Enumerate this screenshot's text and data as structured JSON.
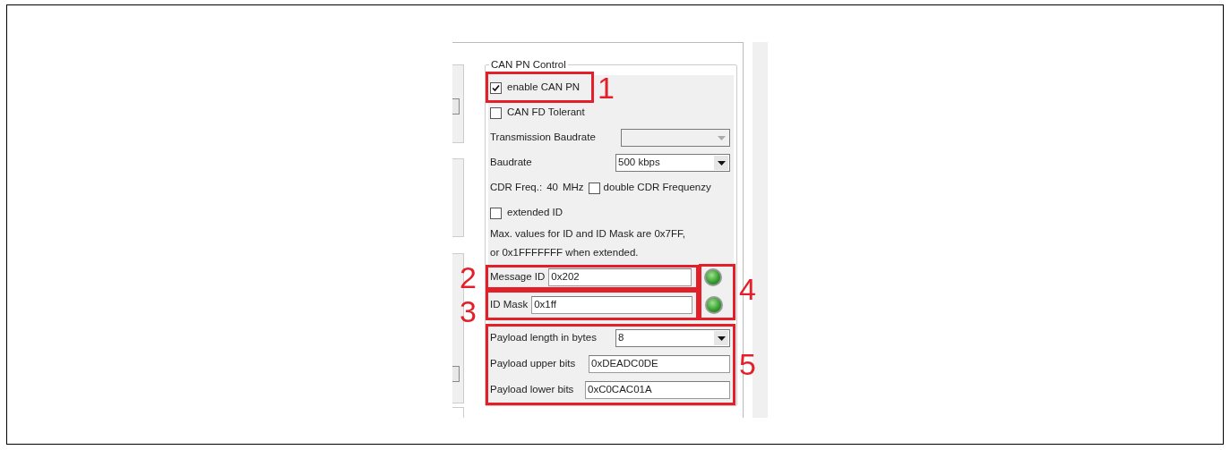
{
  "group_title": "CAN PN Control",
  "enable_can_pn": {
    "label": "enable CAN PN",
    "checked": true
  },
  "can_fd_tolerant": {
    "label": "CAN FD Tolerant",
    "checked": false
  },
  "transmission_baudrate": {
    "label": "Transmission Baudrate",
    "disabled": true
  },
  "baudrate": {
    "label": "Baudrate",
    "value": "500 kbps"
  },
  "cdr": {
    "label": "CDR Freq.:",
    "value": "40",
    "unit": "MHz",
    "double": {
      "label": "double CDR Frequenzy",
      "checked": false
    }
  },
  "extended_id": {
    "label": "extended ID",
    "checked": false
  },
  "note_lines": [
    "Max. values for ID and ID Mask are 0x7FF,",
    "or 0x1FFFFFFF when extended."
  ],
  "message_id": {
    "label": "Message ID",
    "value": "0x202",
    "led_on": true
  },
  "id_mask": {
    "label": "ID Mask",
    "value": "0x1ff",
    "led_on": true
  },
  "payload_length": {
    "label": "Payload length in bytes",
    "value": "8"
  },
  "payload_upper": {
    "label": "Payload upper bits",
    "value": "0xDEADC0DE"
  },
  "payload_lower": {
    "label": "Payload lower bits",
    "value": "0xC0CAC01A"
  },
  "callouts": [
    "1",
    "2",
    "3",
    "4",
    "5"
  ]
}
